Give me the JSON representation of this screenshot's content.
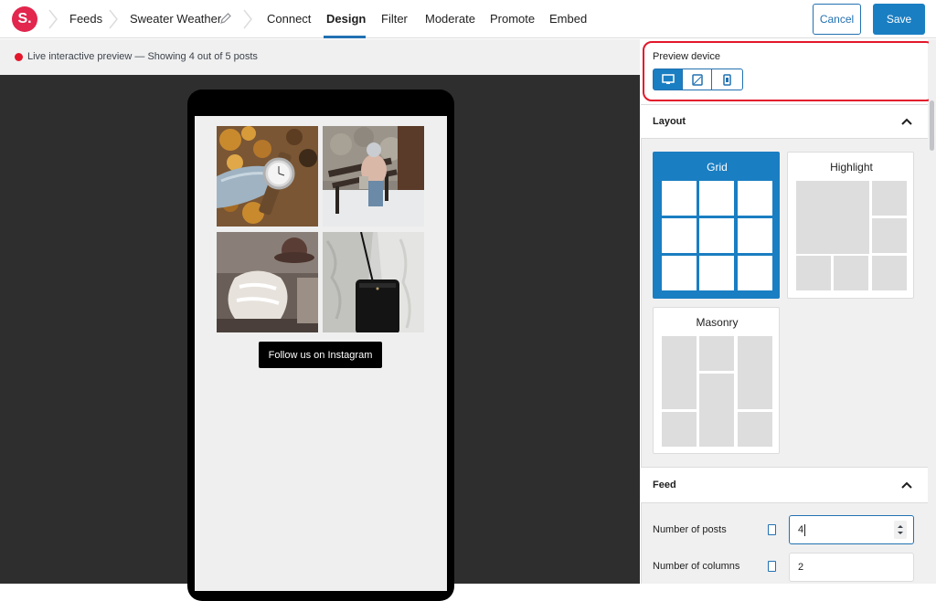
{
  "header": {
    "logo_letter": "S.",
    "breadcrumb": [
      "Feeds",
      "Sweater Weather"
    ],
    "tabs": [
      {
        "label": "Connect",
        "active": false
      },
      {
        "label": "Design",
        "active": true
      },
      {
        "label": "Filter",
        "active": false
      },
      {
        "label": "Moderate",
        "active": false
      },
      {
        "label": "Promote",
        "active": false
      },
      {
        "label": "Embed",
        "active": false
      }
    ],
    "cancel_label": "Cancel",
    "save_label": "Save"
  },
  "preview": {
    "status_text": "Live interactive preview — Showing 4 out of 5 posts",
    "follow_button": "Follow us on Instagram",
    "posts": [
      "watch-photo",
      "bench-photo",
      "hat-photo",
      "bag-photo"
    ]
  },
  "sidebar": {
    "preview_device": {
      "label": "Preview device",
      "options": [
        "desktop-icon",
        "tablet-icon",
        "phone-icon"
      ],
      "selected": "desktop-icon"
    },
    "layout_section": {
      "title": "Layout",
      "options": [
        {
          "label": "Grid",
          "selected": true
        },
        {
          "label": "Highlight",
          "selected": false
        },
        {
          "label": "Masonry",
          "selected": false
        }
      ]
    },
    "feed_section": {
      "title": "Feed",
      "fields": [
        {
          "label": "Number of posts",
          "value": "4"
        },
        {
          "label": "Number of columns",
          "value": "2"
        }
      ]
    }
  },
  "colors": {
    "accent": "#1a7ec2",
    "brand_logo": "#e2264d",
    "live_dot": "#e3172b",
    "highlight_box": "#e3172b"
  }
}
